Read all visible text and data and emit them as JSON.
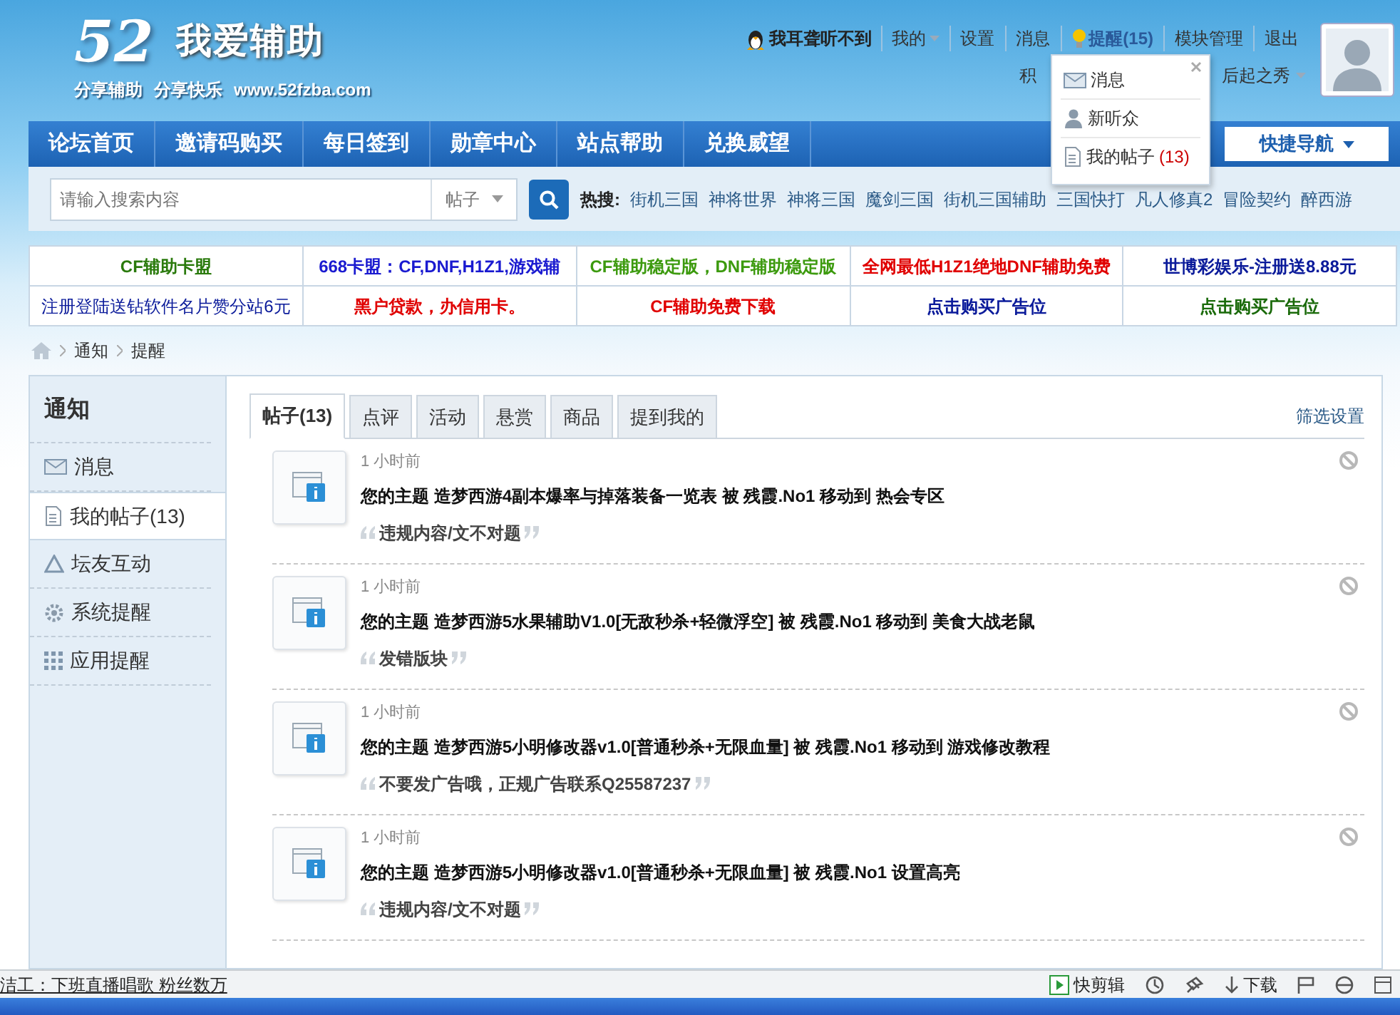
{
  "logo": {
    "number": "52",
    "title": "我爱辅助",
    "taglines": [
      "分享辅助",
      "分享快乐",
      "www.52fzba.com"
    ]
  },
  "user_bar": {
    "username": "我耳聋听不到",
    "links": [
      {
        "label": "我的",
        "kind": "menu"
      },
      {
        "label": "设置",
        "kind": "link"
      },
      {
        "label": "消息",
        "kind": "link"
      },
      {
        "label": "提醒(15)",
        "kind": "alert"
      },
      {
        "label": "模块管理",
        "kind": "link"
      },
      {
        "label": "退出",
        "kind": "link"
      }
    ],
    "credit_label": "积",
    "rank": "后起之秀"
  },
  "alert_menu": {
    "items": [
      {
        "label": "消息"
      },
      {
        "label": "新听众"
      },
      {
        "label": "我的帖子",
        "count": "(13)"
      }
    ]
  },
  "nav": {
    "items": [
      "论坛首页",
      "邀请码购买",
      "每日签到",
      "勋章中心",
      "站点帮助",
      "兑换威望"
    ],
    "quick_nav": "快捷导航"
  },
  "search": {
    "placeholder": "请输入搜索内容",
    "scope": "帖子",
    "hot_label": "热搜:",
    "hot_terms": [
      "街机三国",
      "神将世界",
      "神将三国",
      "魔剑三国",
      "街机三国辅助",
      "三国快打",
      "凡人修真2",
      "冒险契约",
      "醉西游"
    ]
  },
  "ads": [
    [
      {
        "text": "CF辅助卡盟",
        "color": "#2a7a0c",
        "bold": true
      },
      {
        "text": "668卡盟：CF,DNF,H1Z1,游戏辅",
        "color": "#1a1ad0",
        "bold": true
      },
      {
        "text": "CF辅助稳定版，DNF辅助稳定版",
        "color": "#3c9a0e",
        "bold": true
      },
      {
        "text": "全网最低H1Z1绝地DNF辅助免费",
        "color": "#e00000",
        "bold": true
      },
      {
        "text": "世博彩娱乐-注册送8.88元",
        "color": "#0a1a9a",
        "bold": true
      }
    ],
    [
      {
        "text": "注册登陆送钻软件名片赞分站6元",
        "color": "#0a1a9a",
        "bold": false
      },
      {
        "text": "黑户贷款，办信用卡。",
        "color": "#e00000",
        "bold": true
      },
      {
        "text": "CF辅助免费下载",
        "color": "#e00000",
        "bold": true
      },
      {
        "text": "点击购买广告位",
        "color": "#0a1a9a",
        "bold": true
      },
      {
        "text": "点击购买广告位",
        "color": "#1a6a0a",
        "bold": true
      }
    ]
  ],
  "breadcrumb": [
    "通知",
    "提醒"
  ],
  "sidebar": {
    "title": "通知",
    "items": [
      {
        "label": "消息",
        "selected": false
      },
      {
        "label": "我的帖子(13)",
        "selected": true
      },
      {
        "label": "坛友互动",
        "selected": false
      },
      {
        "label": "系统提醒",
        "selected": false
      },
      {
        "label": "应用提醒",
        "selected": false
      }
    ]
  },
  "tabs": [
    {
      "label": "帖子(13)",
      "selected": true
    },
    {
      "label": "点评",
      "selected": false
    },
    {
      "label": "活动",
      "selected": false
    },
    {
      "label": "悬赏",
      "selected": false
    },
    {
      "label": "商品",
      "selected": false
    },
    {
      "label": "提到我的",
      "selected": false
    }
  ],
  "filter_link": "筛选设置",
  "notifications": [
    {
      "time": "1 小时前",
      "subject_label": "您的主题",
      "thread": "造梦西游4副本爆率与掉落装备一览表",
      "by_label": "被",
      "user": "残霞.No1",
      "action": "移动到",
      "target": "热会专区",
      "reason": "违规内容/文不对题"
    },
    {
      "time": "1 小时前",
      "subject_label": "您的主题",
      "thread": "造梦西游5水果辅助V1.0[无敌秒杀+轻微浮空]",
      "by_label": "被",
      "user": "残霞.No1",
      "action": "移动到",
      "target": "美食大战老鼠",
      "reason": "发错版块"
    },
    {
      "time": "1 小时前",
      "subject_label": "您的主题",
      "thread": "造梦西游5小明修改器v1.0[普通秒杀+无限血量]",
      "by_label": "被",
      "user": "残霞.No1",
      "action": "移动到",
      "target": "游戏修改教程",
      "reason": "不要发广告哦，正规广告联系Q25587237"
    },
    {
      "time": "1 小时前",
      "subject_label": "您的主题",
      "thread": "造梦西游5小明修改器v1.0[普通秒杀+无限血量]",
      "by_label": "被",
      "user": "残霞.No1",
      "action": "设置高亮",
      "reason": "违规内容/文不对题"
    }
  ],
  "status_bar": {
    "text": "洁工：下班直播唱歌 粉丝数万",
    "clip_label": "快剪辑",
    "download_label": "下载"
  }
}
